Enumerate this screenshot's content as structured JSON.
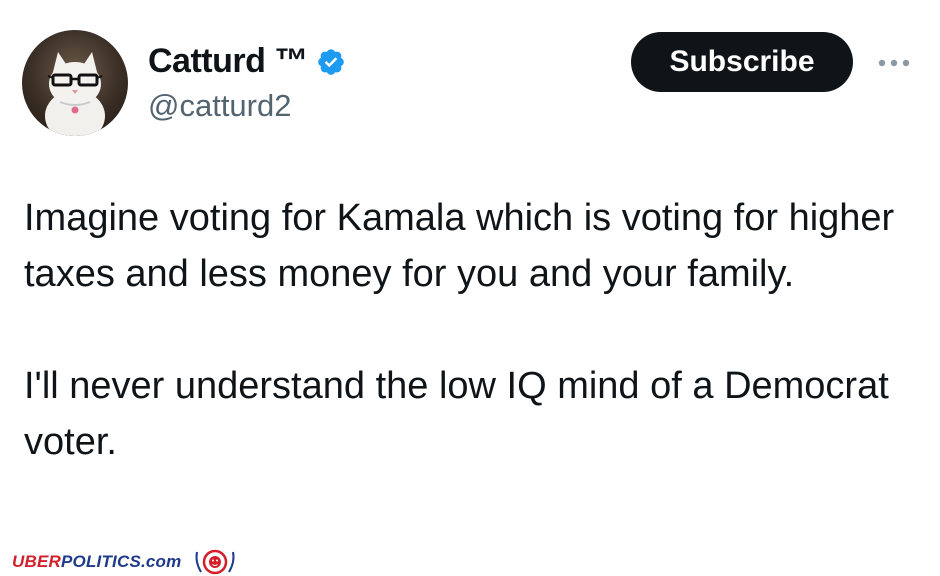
{
  "tweet": {
    "author": {
      "display_name": "Catturd ™",
      "handle": "@catturd2",
      "verified": true,
      "avatar_icon": "cat-with-glasses-avatar"
    },
    "subscribe_label": "Subscribe",
    "more_icon": "more-horizontal-icon",
    "paragraphs": [
      "Imagine voting for Kamala which is voting for higher taxes and less money for you and your family.",
      "I'll never understand the low IQ mind of a Democrat voter."
    ]
  },
  "watermark": {
    "part_uber": "UBER",
    "part_politics": "POLITICS",
    "part_com": ".com",
    "logo_icon": "lion-crest-logo"
  },
  "colors": {
    "text": "#0f1419",
    "handle": "#536471",
    "verified": "#1d9bf0",
    "button_bg": "#0f1419",
    "watermark_red": "#d21f2a",
    "watermark_blue": "#1e3a8a"
  }
}
